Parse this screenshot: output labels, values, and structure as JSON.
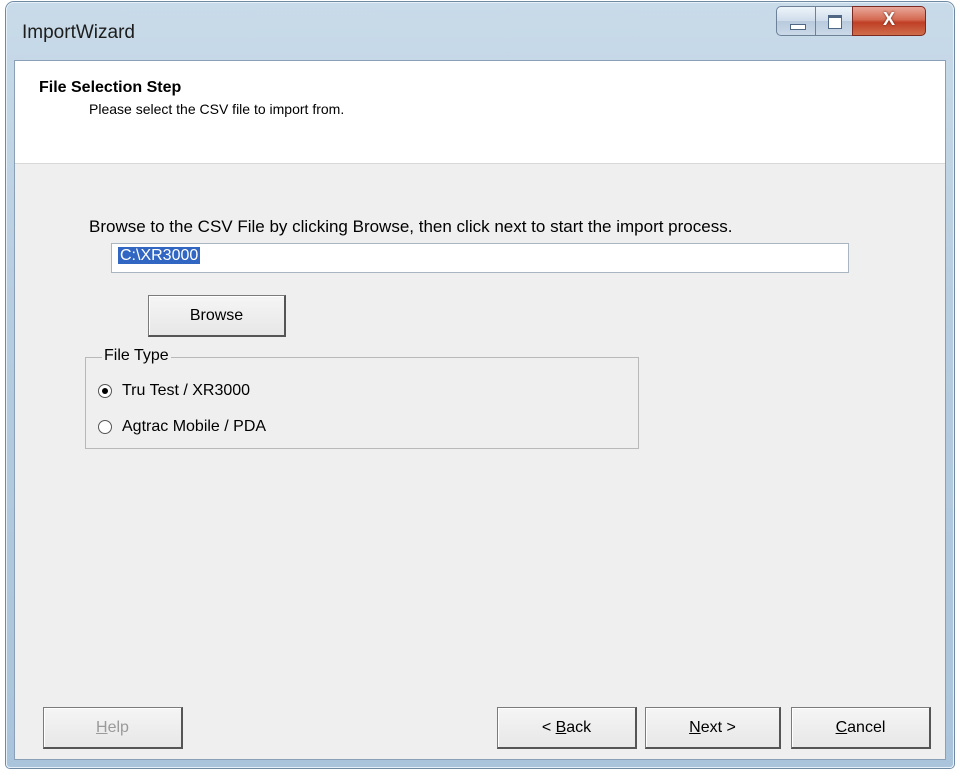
{
  "window": {
    "title": "ImportWizard",
    "controls": {
      "minimize": "minimize",
      "maximize": "maximize",
      "close": "X"
    }
  },
  "header": {
    "step_title": "File Selection Step",
    "step_description": "Please select the CSV  file to import from."
  },
  "main": {
    "instruction": "Browse to the CSV File by clicking Browse, then click next to start the import process.",
    "path_value": "C:\\XR3000",
    "browse_label": "Browse",
    "file_type": {
      "legend": "File Type",
      "options": [
        {
          "label": "Tru Test / XR3000",
          "checked": true
        },
        {
          "label": "Agtrac Mobile / PDA",
          "checked": false
        }
      ]
    }
  },
  "footer": {
    "help": {
      "mnemonic": "H",
      "rest": "elp",
      "enabled": false
    },
    "back": {
      "prefix": "< ",
      "mnemonic": "B",
      "rest": "ack"
    },
    "next": {
      "mnemonic": "N",
      "rest": "ext >"
    },
    "cancel": {
      "mnemonic": "C",
      "rest": "ancel"
    }
  },
  "icons": {
    "minimize": "minimize-icon",
    "maximize": "maximize-icon",
    "close": "close-icon",
    "radio_checked": "radio-checked-icon",
    "radio_unchecked": "radio-unchecked-icon"
  }
}
